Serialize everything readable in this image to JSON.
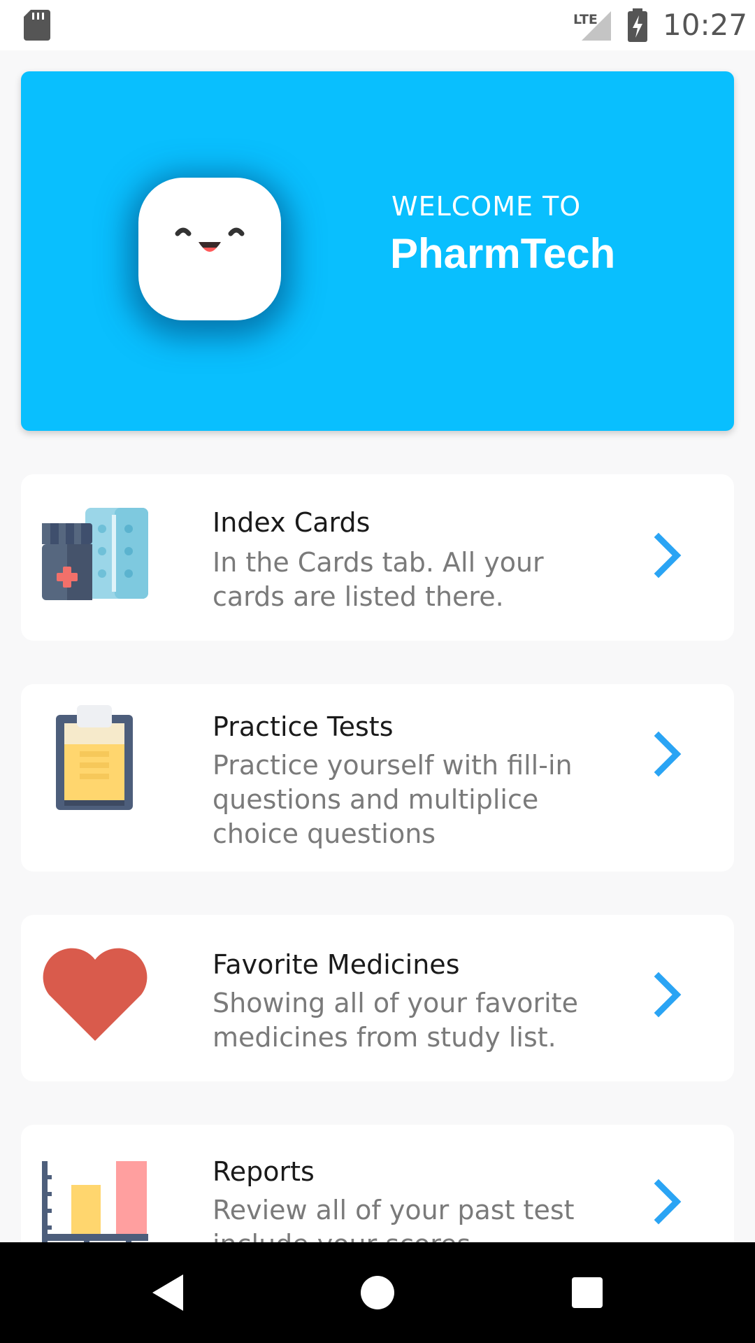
{
  "status_bar": {
    "time": "10:27",
    "network": "LTE",
    "icons": [
      "sd-card-icon",
      "lte-signal-icon",
      "battery-charging-icon"
    ]
  },
  "hero": {
    "welcome": "WELCOME TO",
    "app_name": "PharmTech",
    "background": "#09bffe",
    "mascot_icon": "smiling-face-icon"
  },
  "menu": {
    "items": [
      {
        "title": "Index Cards",
        "description": "In the Cards tab. All your cards are listed there.",
        "icon": "medicine-bottle-pills-icon"
      },
      {
        "title": "Practice Tests",
        "description": "Practice yourself with fill-in questions and multiplice choice questions",
        "icon": "clipboard-icon"
      },
      {
        "title": "Favorite Medicines",
        "description": "Showing all of your favorite medicines from study list.",
        "icon": "heart-icon"
      },
      {
        "title": "Reports",
        "description": "Review all of your past test include your scores",
        "icon": "bar-chart-icon"
      }
    ],
    "chevron_color": "#2aa4f4"
  },
  "nav_bar": {
    "buttons": [
      "back-icon",
      "home-icon",
      "recents-icon"
    ]
  }
}
